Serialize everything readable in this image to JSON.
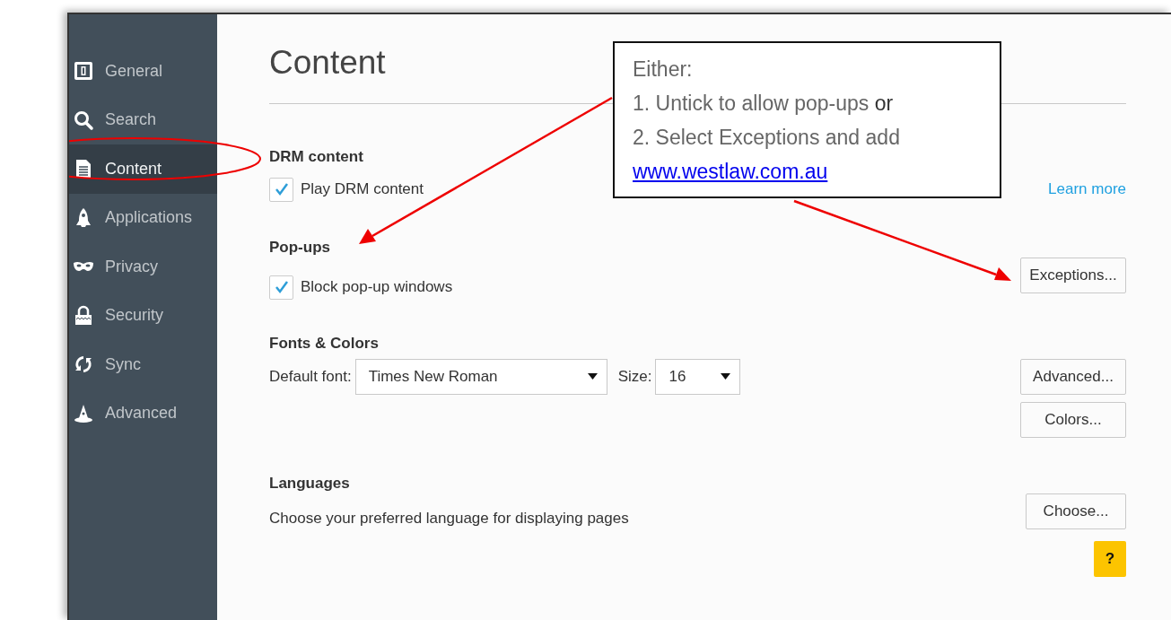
{
  "sidebar": {
    "items": [
      {
        "label": "General",
        "selected": false
      },
      {
        "label": "Search",
        "selected": false
      },
      {
        "label": "Content",
        "selected": true
      },
      {
        "label": "Applications",
        "selected": false
      },
      {
        "label": "Privacy",
        "selected": false
      },
      {
        "label": "Security",
        "selected": false
      },
      {
        "label": "Sync",
        "selected": false
      },
      {
        "label": "Advanced",
        "selected": false
      }
    ]
  },
  "page_title": "Content",
  "drm": {
    "heading": "DRM content",
    "checkbox": {
      "label": "Play DRM content",
      "checked": true
    },
    "link": "Learn more"
  },
  "popups": {
    "heading": "Pop-ups",
    "checkbox": {
      "label": "Block pop-up windows",
      "checked": true
    },
    "button": "Exceptions..."
  },
  "fonts": {
    "heading": "Fonts & Colors",
    "font_label": "Default font:",
    "font_value": "Times New Roman",
    "size_label": "Size:",
    "size_value": "16",
    "buttons": [
      "Advanced...",
      "Colors..."
    ]
  },
  "languages": {
    "heading": "Languages",
    "text": "Choose your preferred language for displaying pages",
    "button": "Choose..."
  },
  "help_button": "?",
  "callout": {
    "lines": [
      "Either:",
      "1. Untick to allow pop-ups **or**",
      "2. Select Exceptions and add"
    ],
    "link": "www.westlaw.com.au"
  }
}
